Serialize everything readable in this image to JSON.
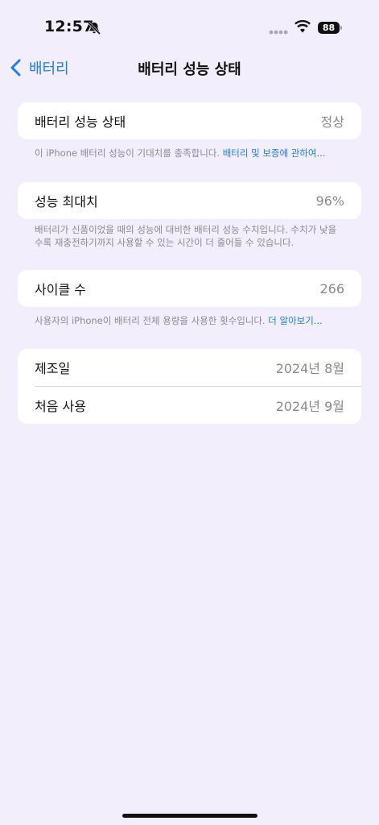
{
  "status_bar": {
    "time": "12:57",
    "battery_level": "88"
  },
  "nav": {
    "back_label": "배터리",
    "title": "배터리 성능 상태"
  },
  "health": {
    "label": "배터리 성능 상태",
    "value": "정상",
    "footnote_text": "이 iPhone 배터리 성능이 기대치를 충족합니다. ",
    "footnote_link": "배터리 및 보증에 관하여..."
  },
  "max_capacity": {
    "label": "성능 최대치",
    "value": "96%",
    "footnote": "배터리가 신품이었을 때의 성능에 대비한 배터리 성능 수치입니다. 수치가 낮을수록 재충전하기까지 사용할 수 있는 시간이 더 줄어들 수 있습니다."
  },
  "cycle": {
    "label": "사이클 수",
    "value": "266",
    "footnote_text": "사용자의 iPhone이 배터리 전체 용량을 사용한 횟수입니다. ",
    "footnote_link": "더 알아보기..."
  },
  "dates": {
    "manufacture_label": "제조일",
    "manufacture_value": "2024년 8월",
    "first_use_label": "처음 사용",
    "first_use_value": "2024년 9월"
  },
  "colors": {
    "background": "#f3eefc",
    "accent": "#1f7cf2"
  }
}
